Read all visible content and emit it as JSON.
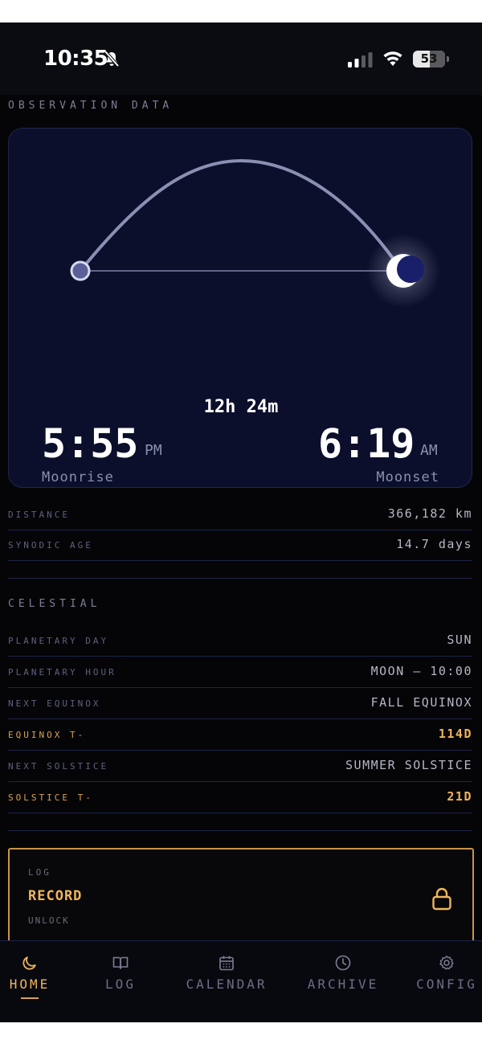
{
  "status": {
    "time": "10:35",
    "battery": "53",
    "battery_level": 0.53
  },
  "observation": {
    "section_title": "OBSERVATION DATA",
    "duration": "12h 24m",
    "moonrise": {
      "time": "5:55",
      "ampm": "PM",
      "label": "Moonrise"
    },
    "moonset": {
      "time": "6:19",
      "ampm": "AM",
      "label": "Moonset"
    }
  },
  "metrics": [
    {
      "label": "DISTANCE",
      "value": "366,182 km"
    },
    {
      "label": "SYNODIC AGE",
      "value": "14.7 days"
    }
  ],
  "celestial": {
    "section_title": "CELESTIAL",
    "rows": [
      {
        "label": "PLANETARY DAY",
        "value": "SUN"
      },
      {
        "label": "PLANETARY HOUR",
        "value": "MOON — 10:00"
      },
      {
        "label": "NEXT EQUINOX",
        "value": "FALL EQUINOX"
      },
      {
        "label": "EQUINOX T-",
        "value": "114D"
      },
      {
        "label": "NEXT SOLSTICE",
        "value": "SUMMER SOLSTICE"
      },
      {
        "label": "SOLSTICE T-",
        "value": "21D"
      }
    ]
  },
  "log_card": {
    "kicker": "LOG",
    "title": "RECORD",
    "subtitle": "UNLOCK",
    "icon": "lock-icon"
  },
  "nav": [
    {
      "label": "HOME",
      "icon": "moon-icon",
      "active": true
    },
    {
      "label": "LOG",
      "icon": "book-icon",
      "active": false
    },
    {
      "label": "CALENDAR",
      "icon": "calendar-icon",
      "active": false
    },
    {
      "label": "ARCHIVE",
      "icon": "clock-icon",
      "active": false
    },
    {
      "label": "CONFIG",
      "icon": "gear-icon",
      "active": false
    }
  ],
  "colors": {
    "accent": "#f0b55a",
    "card_bg": "#0c0f2b",
    "background": "#050507"
  }
}
